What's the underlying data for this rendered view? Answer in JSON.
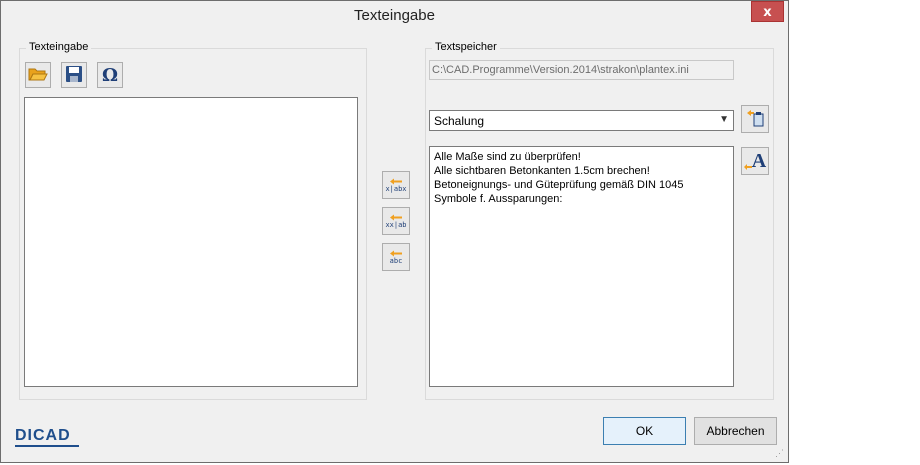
{
  "window": {
    "title": "Texteingabe",
    "close_label": "x"
  },
  "left_group": {
    "label": "Texteingabe"
  },
  "right_group": {
    "label": "Textspeicher",
    "path": "C:\\CAD.Programme\\Version.2014\\strakon\\plantex.ini",
    "select_value": "Schalung",
    "lines": [
      "Alle Maße sind zu überprüfen!",
      "Alle sichtbaren Betonkanten 1.5cm brechen!",
      "Betoneignungs- und Güteprüfung gemäß DIN 1045",
      "Symbole f. Aussparungen:"
    ]
  },
  "mid_buttons": {
    "b1": "x|abx",
    "b2": "xx|ab",
    "b3": "abc"
  },
  "buttons": {
    "ok": "OK",
    "cancel": "Abbrechen"
  },
  "logo": "DICAD",
  "icons": [
    "open-folder-icon",
    "save-icon",
    "omega-icon",
    "copy-to-clipboard-icon",
    "font-icon",
    "insert-left-icon"
  ],
  "colors": {
    "close_red": "#c75050",
    "logo_blue": "#1f4e8c",
    "accent_orange": "#f0a020"
  }
}
